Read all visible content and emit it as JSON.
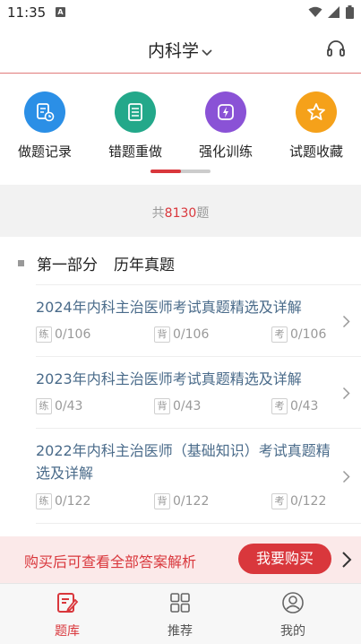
{
  "status_bar": {
    "time": "11:35",
    "sim_icon": "A"
  },
  "header": {
    "title": "内科学"
  },
  "quick_actions": [
    {
      "label": "做题记录",
      "icon": "record-icon",
      "color": "#2b8fe6"
    },
    {
      "label": "错题重做",
      "icon": "list-icon",
      "color": "#23a88a"
    },
    {
      "label": "强化训练",
      "icon": "lightning-icon",
      "color": "#8a52d6"
    },
    {
      "label": "试题收藏",
      "icon": "star-icon",
      "color": "#f5a11a"
    }
  ],
  "summary": {
    "prefix": "共",
    "count": "8130",
    "suffix": "题"
  },
  "section": {
    "part": "第一部分",
    "name": "历年真题",
    "items": [
      {
        "title": "2024年内科主治医师考试真题精选及详解",
        "practice_tag": "练",
        "practice": "0/106",
        "recite_tag": "背",
        "recite": "0/106",
        "exam_tag": "考",
        "exam": "0/106"
      },
      {
        "title": "2023年内科主治医师考试真题精选及详解",
        "practice_tag": "练",
        "practice": "0/43",
        "recite_tag": "背",
        "recite": "0/43",
        "exam_tag": "考",
        "exam": "0/43"
      },
      {
        "title": "2022年内科主治医师（基础知识）考试真题精选及详解",
        "practice_tag": "练",
        "practice": "0/122",
        "recite_tag": "背",
        "recite": "0/122",
        "exam_tag": "考",
        "exam": "0/122"
      }
    ]
  },
  "purchase": {
    "message": "购买后可查看全部答案解析",
    "button": "我要购买"
  },
  "tabs": [
    {
      "label": "题库",
      "icon": "question-bank-icon",
      "active": true
    },
    {
      "label": "推荐",
      "icon": "grid-icon",
      "active": false
    },
    {
      "label": "我的",
      "icon": "profile-icon",
      "active": false
    }
  ],
  "colors": {
    "accent": "#d9373c",
    "link": "#4a6b8a"
  }
}
